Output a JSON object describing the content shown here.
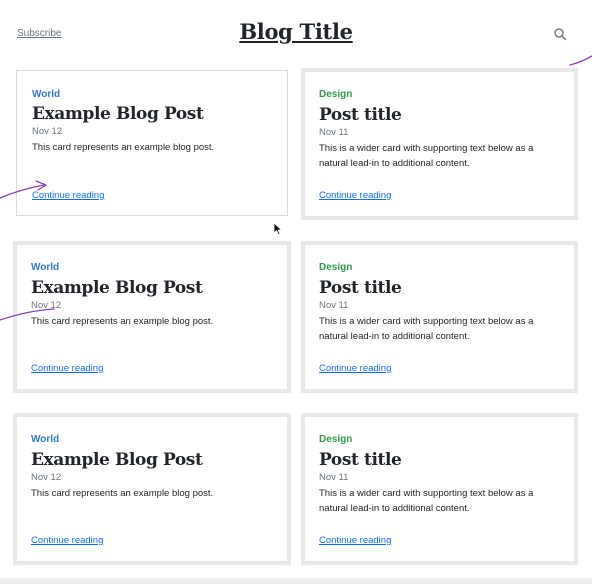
{
  "header": {
    "subscribe_label": "Subscribe",
    "title": "Blog Title",
    "search_icon": "search-icon"
  },
  "colors": {
    "world": "#3077d6",
    "design": "#2f9a4b",
    "link": "#0d6efd",
    "annotation": "#8a3fbf"
  },
  "cards": [
    {
      "category": "World",
      "title": "Example Blog Post",
      "date": "Nov 12",
      "excerpt": "This card represents an example blog post.",
      "link": "Continue reading"
    },
    {
      "category": "Design",
      "title": "Post title",
      "date": "Nov 11",
      "excerpt": "This is a wider card with supporting text below as a natural lead-in to additional content.",
      "link": "Continue reading"
    },
    {
      "category": "World",
      "title": "Example Blog Post",
      "date": "Nov 12",
      "excerpt": "This card represents an example blog post.",
      "link": "Continue reading"
    },
    {
      "category": "Design",
      "title": "Post title",
      "date": "Nov 11",
      "excerpt": "This is a wider card with supporting text below as a natural lead-in to additional content.",
      "link": "Continue reading"
    },
    {
      "category": "World",
      "title": "Example Blog Post",
      "date": "Nov 12",
      "excerpt": "This card represents an example blog post.",
      "link": "Continue reading"
    },
    {
      "category": "Design",
      "title": "Post title",
      "date": "Nov 11",
      "excerpt": "This is a wider card with supporting text below as a natural lead-in to additional content.",
      "link": "Continue reading"
    }
  ]
}
